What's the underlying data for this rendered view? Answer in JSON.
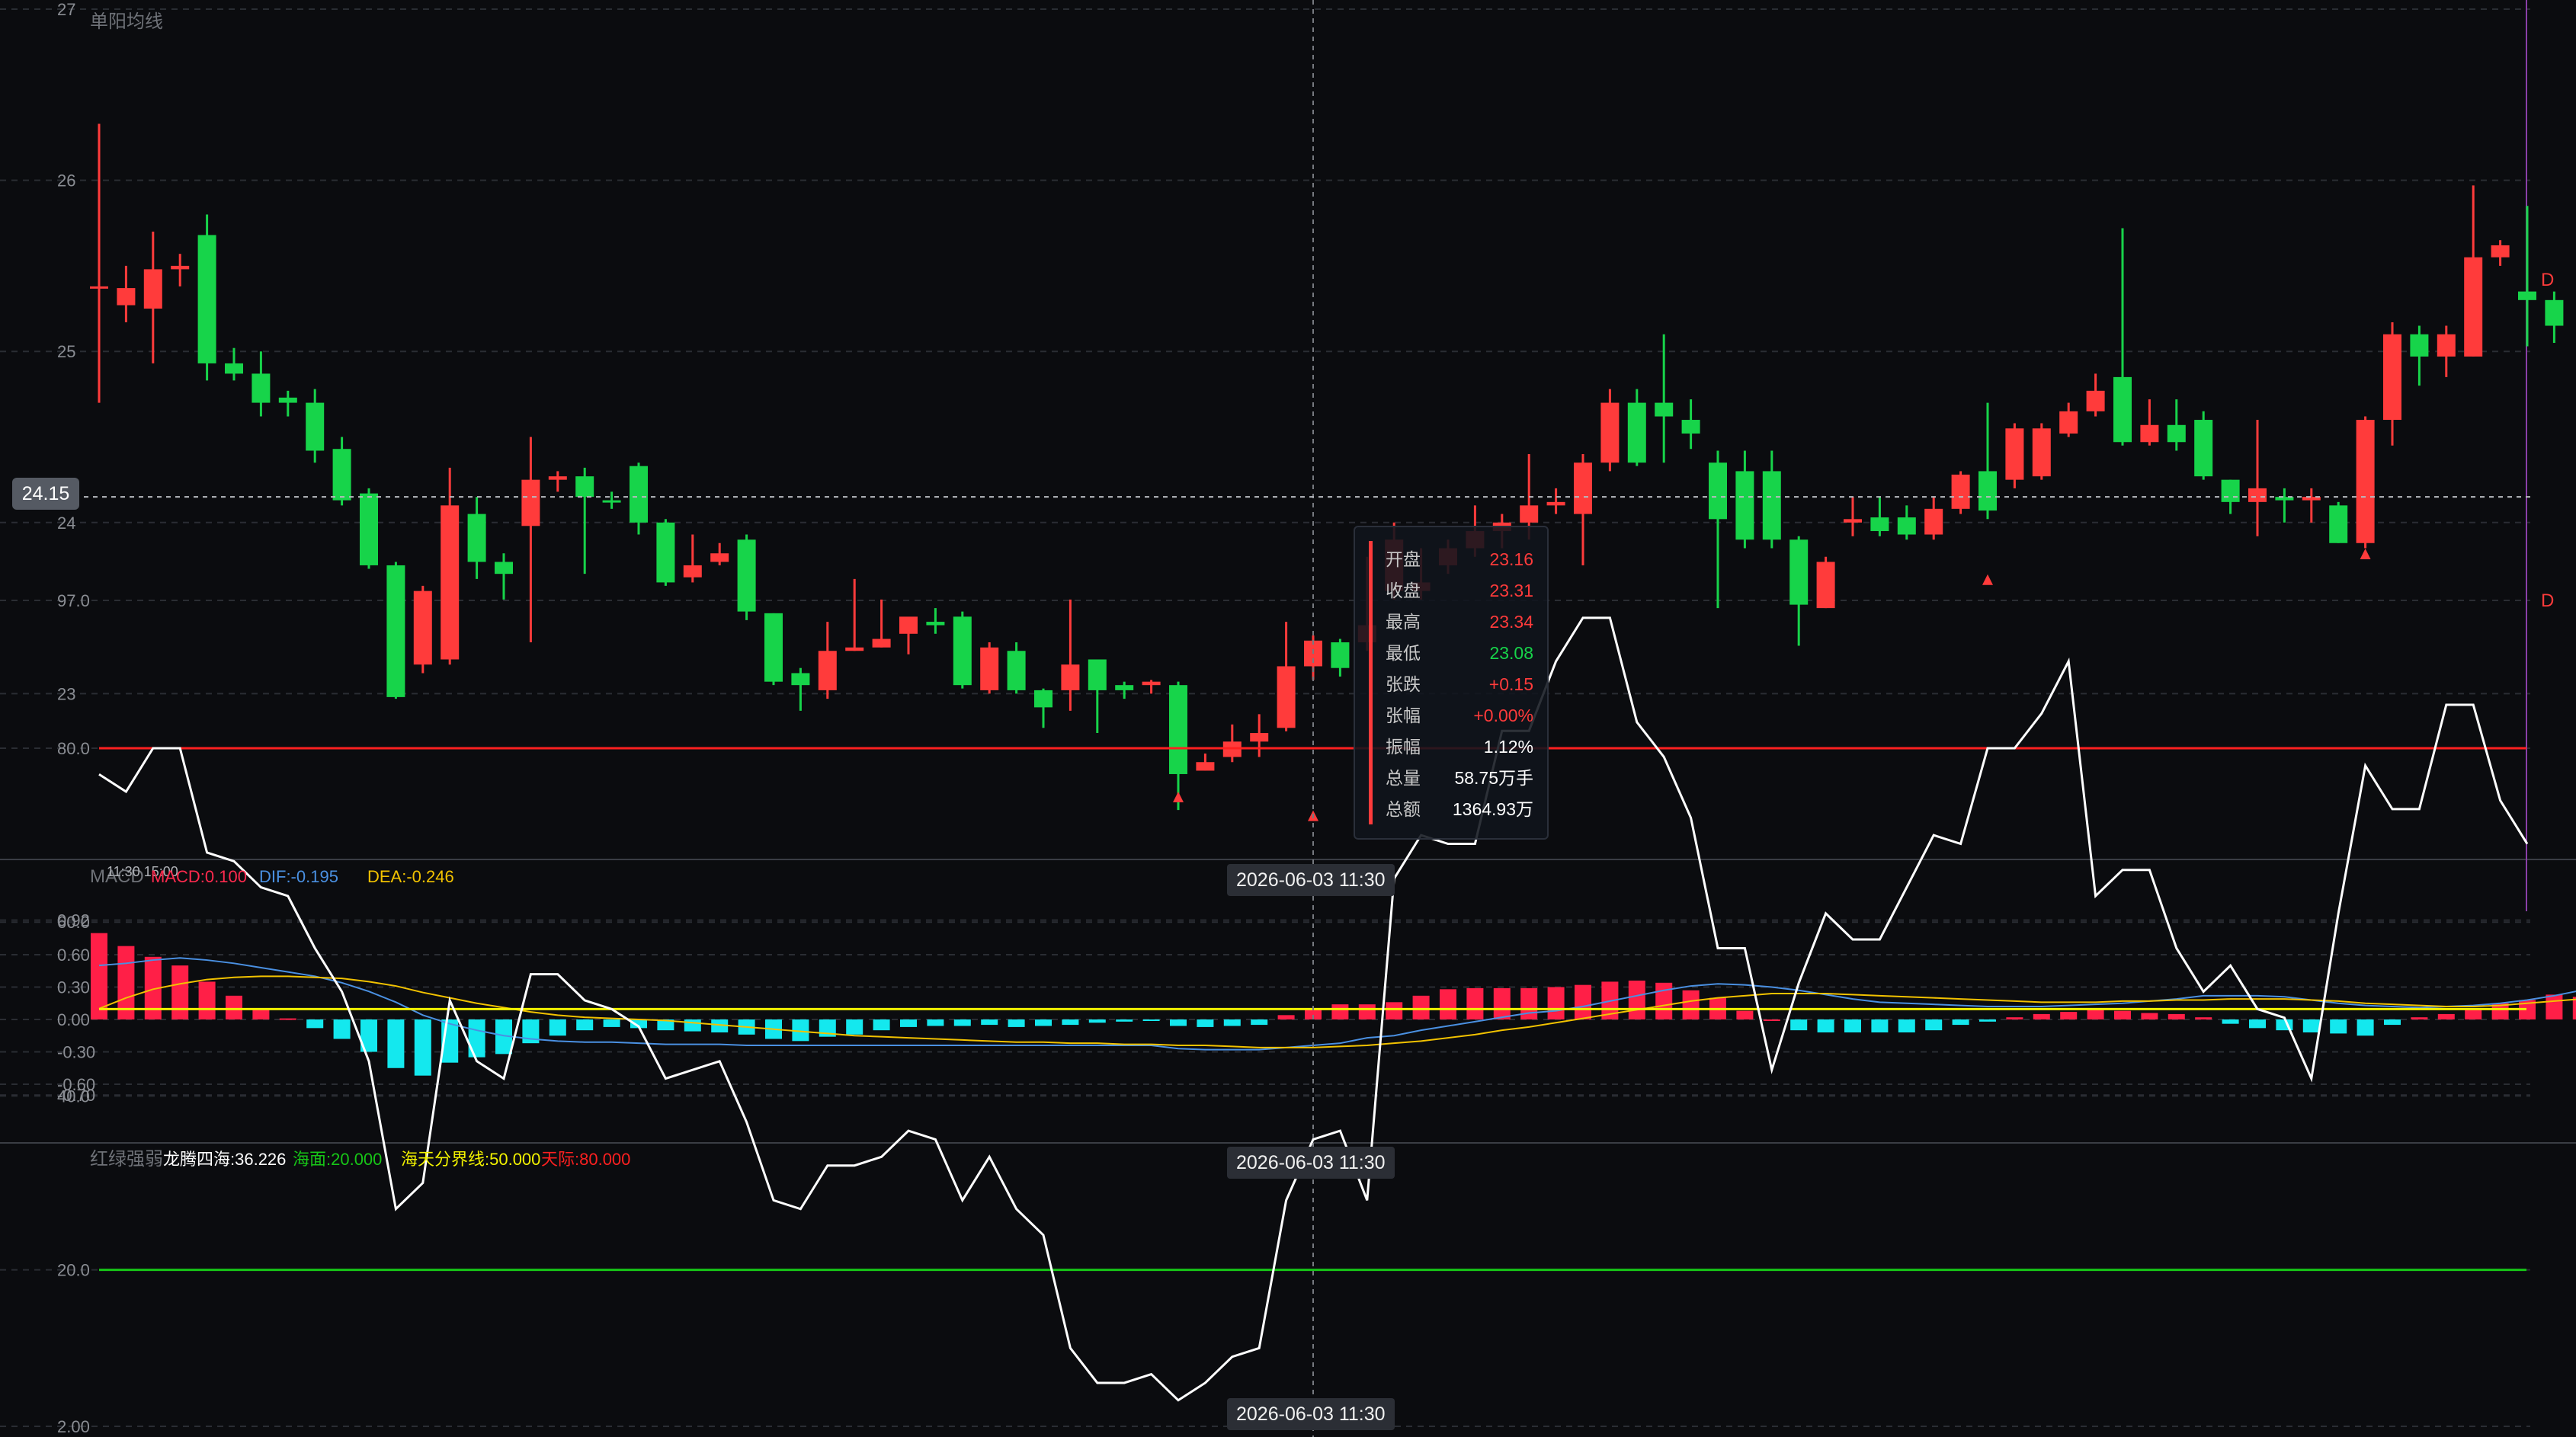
{
  "panels": {
    "main": {
      "title": "单阳均线",
      "price_marker": "24.15",
      "right_markers": [
        "D",
        "D"
      ]
    },
    "macd": {
      "label": "MACD",
      "legend": [
        {
          "text": "MACD:0.100",
          "color": "#ff2a4e"
        },
        {
          "text": "DIF:-0.195",
          "color": "#4a90e2"
        },
        {
          "text": "DEA:-0.246",
          "color": "#f2c200"
        }
      ],
      "overlap_text": "11:30 15:00"
    },
    "osc": {
      "label": "红绿强弱",
      "legend": [
        {
          "text": "龙腾四海:36.226",
          "color": "#ffffff"
        },
        {
          "text": "海面:20.000",
          "color": "#17c617"
        },
        {
          "text": "海天分界线:50.000",
          "color": "#f2f200"
        },
        {
          "text": "天际:80.000",
          "color": "#ff2020"
        }
      ]
    }
  },
  "crosshair": {
    "time_label": "2026-06-03 11:30",
    "price": "24.15"
  },
  "tooltip": {
    "rows": [
      {
        "k": "开盘",
        "v": "23.16",
        "color": "#ff3b3b"
      },
      {
        "k": "收盘",
        "v": "23.31",
        "color": "#ff3b3b"
      },
      {
        "k": "最高",
        "v": "23.34",
        "color": "#ff3b3b"
      },
      {
        "k": "最低",
        "v": "23.08",
        "color": "#17d44a"
      },
      {
        "k": "张跌",
        "v": "+0.15",
        "color": "#ff3b3b"
      },
      {
        "k": "张幅",
        "v": "+0.00%",
        "color": "#ff3b3b"
      },
      {
        "k": "振幅",
        "v": "1.12%",
        "color": "#ffffff"
      },
      {
        "k": "总量",
        "v": "58.75万手",
        "color": "#ffffff"
      },
      {
        "k": "总额",
        "v": "1364.93万",
        "color": "#ffffff"
      }
    ]
  },
  "colors": {
    "up": "#ff3b3b",
    "down": "#17d44a",
    "macd_up": "#ff1f47",
    "macd_down": "#14e8ee",
    "dif": "#4a90e2",
    "dea": "#f2c200",
    "osc_line": "#ffffff",
    "level_80": "#ff2020",
    "level_50": "#f2f200",
    "level_20": "#17c617",
    "grid": "#2a2d33"
  },
  "chart_data": [
    {
      "type": "candlestick",
      "title": "单阳均线",
      "ylim": [
        22.0,
        27.0
      ],
      "yticks": [
        "27",
        "26",
        "25",
        "24",
        "23"
      ],
      "ohlc": [
        [
          25.37,
          25.38,
          26.33,
          24.7
        ],
        [
          25.27,
          25.37,
          25.5,
          25.17
        ],
        [
          25.25,
          25.48,
          25.7,
          24.93
        ],
        [
          25.48,
          25.5,
          25.57,
          25.38
        ],
        [
          25.68,
          24.93,
          25.8,
          24.83
        ],
        [
          24.93,
          24.87,
          25.02,
          24.83
        ],
        [
          24.87,
          24.7,
          25.0,
          24.62
        ],
        [
          24.73,
          24.7,
          24.77,
          24.62
        ],
        [
          24.7,
          24.42,
          24.78,
          24.35
        ],
        [
          24.43,
          24.13,
          24.5,
          24.1
        ],
        [
          24.17,
          23.75,
          24.2,
          23.73
        ],
        [
          23.75,
          22.98,
          23.77,
          22.97
        ],
        [
          23.17,
          23.6,
          23.63,
          23.12
        ],
        [
          23.2,
          24.1,
          24.32,
          23.17
        ],
        [
          24.05,
          23.77,
          24.15,
          23.67
        ],
        [
          23.77,
          23.7,
          23.82,
          23.55
        ],
        [
          23.98,
          24.25,
          24.5,
          23.3
        ],
        [
          24.25,
          24.27,
          24.3,
          24.18
        ],
        [
          24.27,
          24.15,
          24.32,
          23.7
        ],
        [
          24.13,
          24.12,
          24.18,
          24.08
        ],
        [
          24.33,
          24.0,
          24.35,
          23.93
        ],
        [
          24.0,
          23.65,
          24.02,
          23.63
        ],
        [
          23.68,
          23.75,
          23.93,
          23.65
        ],
        [
          23.77,
          23.82,
          23.88,
          23.75
        ],
        [
          23.9,
          23.48,
          23.93,
          23.43
        ],
        [
          23.47,
          23.07,
          23.47,
          23.05
        ],
        [
          23.12,
          23.05,
          23.15,
          22.9
        ],
        [
          23.02,
          23.25,
          23.42,
          22.97
        ],
        [
          23.25,
          23.27,
          23.67,
          23.25
        ],
        [
          23.27,
          23.32,
          23.55,
          23.27
        ],
        [
          23.35,
          23.45,
          23.43,
          23.23
        ],
        [
          23.42,
          23.4,
          23.5,
          23.35
        ],
        [
          23.45,
          23.05,
          23.48,
          23.03
        ],
        [
          23.02,
          23.27,
          23.3,
          23.0
        ],
        [
          23.25,
          23.02,
          23.3,
          23.0
        ],
        [
          23.02,
          22.92,
          23.03,
          22.8
        ],
        [
          23.02,
          23.17,
          23.55,
          22.9
        ],
        [
          23.2,
          23.02,
          23.2,
          22.77
        ],
        [
          23.05,
          23.02,
          23.07,
          22.97
        ],
        [
          23.05,
          23.07,
          23.08,
          23.0
        ],
        [
          23.05,
          22.53,
          23.07,
          22.32
        ],
        [
          22.55,
          22.6,
          22.65,
          22.55
        ],
        [
          22.63,
          22.72,
          22.82,
          22.6
        ],
        [
          22.72,
          22.77,
          22.88,
          22.63
        ],
        [
          22.8,
          23.16,
          23.42,
          22.78
        ],
        [
          23.16,
          23.31,
          23.34,
          23.08
        ],
        [
          23.3,
          23.15,
          23.32,
          23.1
        ],
        [
          23.3,
          23.4,
          23.8,
          23.25
        ],
        [
          23.6,
          23.9,
          24.0,
          23.55
        ],
        [
          23.6,
          23.65,
          23.85,
          23.55
        ],
        [
          23.75,
          23.85,
          23.9,
          23.7
        ],
        [
          23.85,
          23.95,
          24.1,
          23.8
        ],
        [
          23.95,
          24.0,
          24.05,
          23.85
        ],
        [
          24.0,
          24.1,
          24.4,
          23.9
        ],
        [
          24.1,
          24.12,
          24.2,
          24.05
        ],
        [
          24.05,
          24.35,
          24.4,
          23.75
        ],
        [
          24.35,
          24.7,
          24.78,
          24.3
        ],
        [
          24.7,
          24.35,
          24.78,
          24.33
        ],
        [
          24.7,
          24.62,
          25.1,
          24.35
        ],
        [
          24.6,
          24.52,
          24.72,
          24.43
        ],
        [
          24.35,
          24.02,
          24.42,
          23.5
        ],
        [
          24.3,
          23.9,
          24.42,
          23.85
        ],
        [
          24.3,
          23.9,
          24.42,
          23.85
        ],
        [
          23.9,
          23.52,
          23.92,
          23.28
        ],
        [
          23.5,
          23.77,
          23.8,
          23.5
        ],
        [
          24.0,
          24.02,
          24.15,
          23.92
        ],
        [
          24.03,
          23.95,
          24.15,
          23.92
        ],
        [
          24.03,
          23.93,
          24.1,
          23.9
        ],
        [
          23.93,
          24.08,
          24.15,
          23.9
        ],
        [
          24.08,
          24.28,
          24.3,
          24.05
        ],
        [
          24.3,
          24.07,
          24.7,
          24.02
        ],
        [
          24.25,
          24.55,
          24.58,
          24.2
        ],
        [
          24.27,
          24.55,
          24.58,
          24.25
        ],
        [
          24.52,
          24.65,
          24.7,
          24.5
        ],
        [
          24.65,
          24.77,
          24.87,
          24.62
        ],
        [
          24.85,
          24.47,
          25.72,
          24.45
        ],
        [
          24.47,
          24.57,
          24.72,
          24.45
        ],
        [
          24.57,
          24.47,
          24.72,
          24.42
        ],
        [
          24.6,
          24.27,
          24.65,
          24.25
        ],
        [
          24.25,
          24.12,
          24.25,
          24.05
        ],
        [
          24.12,
          24.2,
          24.6,
          23.92
        ],
        [
          24.15,
          24.13,
          24.2,
          24.0
        ],
        [
          24.13,
          24.15,
          24.2,
          24.0
        ],
        [
          24.1,
          23.88,
          24.12,
          23.88
        ],
        [
          23.88,
          24.6,
          24.62,
          23.85
        ],
        [
          24.6,
          25.1,
          25.17,
          24.45
        ],
        [
          25.1,
          24.97,
          25.15,
          24.8
        ],
        [
          24.97,
          25.1,
          25.15,
          24.85
        ],
        [
          24.97,
          25.55,
          25.97,
          24.97
        ],
        [
          25.55,
          25.62,
          25.65,
          25.5
        ],
        [
          25.35,
          25.3,
          25.85,
          25.03
        ],
        [
          25.3,
          25.15,
          25.35,
          25.05
        ]
      ],
      "signals": [
        {
          "i": 40,
          "type": "up-arrow",
          "value": 22.53
        },
        {
          "i": 45,
          "type": "up-arrow",
          "value": 22.42
        },
        {
          "i": 70,
          "type": "up-arrow",
          "value": 23.8
        },
        {
          "i": 84,
          "type": "up-arrow",
          "value": 23.95
        }
      ]
    },
    {
      "type": "bar+line",
      "title": "MACD",
      "ylim": [
        -0.7,
        0.92
      ],
      "yticks": [
        "0.92",
        "0.60",
        "0.30",
        "0.00",
        "-0.30",
        "-0.60",
        "-0.70"
      ],
      "series": [
        {
          "name": "MACD",
          "kind": "bar",
          "values": [
            0.8,
            0.68,
            0.58,
            0.5,
            0.35,
            0.22,
            0.1,
            0.01,
            -0.08,
            -0.18,
            -0.3,
            -0.45,
            -0.52,
            -0.4,
            -0.35,
            -0.32,
            -0.22,
            -0.15,
            -0.1,
            -0.07,
            -0.08,
            -0.1,
            -0.11,
            -0.12,
            -0.14,
            -0.18,
            -0.2,
            -0.16,
            -0.14,
            -0.1,
            -0.07,
            -0.06,
            -0.06,
            -0.05,
            -0.07,
            -0.06,
            -0.05,
            -0.03,
            -0.02,
            -0.01,
            -0.06,
            -0.07,
            -0.06,
            -0.05,
            0.04,
            0.1,
            0.14,
            0.14,
            0.16,
            0.22,
            0.28,
            0.29,
            0.29,
            0.29,
            0.3,
            0.32,
            0.35,
            0.36,
            0.34,
            0.27,
            0.2,
            0.08,
            0.0,
            -0.1,
            -0.12,
            -0.12,
            -0.12,
            -0.12,
            -0.1,
            -0.05,
            -0.02,
            0.02,
            0.05,
            0.07,
            0.09,
            0.08,
            0.06,
            0.05,
            0.02,
            -0.04,
            -0.08,
            -0.1,
            -0.12,
            -0.13,
            -0.15,
            -0.05,
            0.02,
            0.05,
            0.09,
            0.15,
            0.18,
            0.23,
            0.21,
            0.16
          ]
        },
        {
          "name": "DIF",
          "kind": "line",
          "values": [
            0.5,
            0.52,
            0.55,
            0.57,
            0.55,
            0.52,
            0.48,
            0.44,
            0.4,
            0.34,
            0.26,
            0.16,
            0.04,
            -0.04,
            -0.1,
            -0.15,
            -0.18,
            -0.2,
            -0.21,
            -0.21,
            -0.22,
            -0.23,
            -0.23,
            -0.23,
            -0.24,
            -0.24,
            -0.24,
            -0.24,
            -0.24,
            -0.24,
            -0.24,
            -0.24,
            -0.24,
            -0.24,
            -0.24,
            -0.24,
            -0.24,
            -0.24,
            -0.24,
            -0.24,
            -0.27,
            -0.28,
            -0.28,
            -0.28,
            -0.26,
            -0.24,
            -0.22,
            -0.17,
            -0.15,
            -0.1,
            -0.06,
            -0.02,
            0.02,
            0.06,
            0.08,
            0.12,
            0.17,
            0.22,
            0.27,
            0.31,
            0.33,
            0.32,
            0.3,
            0.27,
            0.23,
            0.19,
            0.16,
            0.15,
            0.14,
            0.13,
            0.12,
            0.12,
            0.12,
            0.13,
            0.14,
            0.15,
            0.17,
            0.19,
            0.22,
            0.22,
            0.22,
            0.21,
            0.18,
            0.15,
            0.13,
            0.12,
            0.11,
            0.12,
            0.13,
            0.15,
            0.18,
            0.22,
            0.27,
            0.31,
            0.32
          ]
        },
        {
          "name": "DEA",
          "kind": "line",
          "values": [
            0.1,
            0.2,
            0.28,
            0.33,
            0.37,
            0.39,
            0.4,
            0.4,
            0.39,
            0.38,
            0.35,
            0.31,
            0.25,
            0.2,
            0.15,
            0.11,
            0.07,
            0.04,
            0.02,
            0.01,
            0.0,
            -0.01,
            -0.03,
            -0.05,
            -0.07,
            -0.09,
            -0.11,
            -0.13,
            -0.15,
            -0.16,
            -0.17,
            -0.18,
            -0.19,
            -0.2,
            -0.21,
            -0.21,
            -0.22,
            -0.22,
            -0.23,
            -0.23,
            -0.24,
            -0.24,
            -0.25,
            -0.26,
            -0.26,
            -0.26,
            -0.25,
            -0.24,
            -0.22,
            -0.2,
            -0.17,
            -0.14,
            -0.1,
            -0.07,
            -0.03,
            0.01,
            0.05,
            0.09,
            0.13,
            0.17,
            0.2,
            0.22,
            0.24,
            0.24,
            0.24,
            0.23,
            0.22,
            0.21,
            0.2,
            0.19,
            0.18,
            0.17,
            0.16,
            0.16,
            0.16,
            0.17,
            0.17,
            0.18,
            0.18,
            0.19,
            0.19,
            0.19,
            0.18,
            0.17,
            0.15,
            0.14,
            0.13,
            0.12,
            0.12,
            0.13,
            0.15,
            0.17,
            0.19,
            0.22,
            0.24
          ]
        }
      ]
    },
    {
      "type": "line",
      "title": "红绿强弱",
      "ylim": [
        2.0,
        97.0
      ],
      "yticks": [
        "97.0",
        "80.0",
        "60.0",
        "40.0",
        "20.0",
        "2.00"
      ],
      "levels": [
        {
          "name": "天际",
          "value": 80.0
        },
        {
          "name": "海天分界线",
          "value": 50.0
        },
        {
          "name": "海面",
          "value": 20.0
        }
      ],
      "series": [
        {
          "name": "龙腾四海",
          "values": [
            77,
            75,
            80,
            80,
            68,
            67,
            64,
            63,
            57,
            52,
            44,
            27,
            30,
            51,
            44,
            42,
            54,
            54,
            51,
            50,
            48,
            42,
            43,
            44,
            37,
            28,
            27,
            32,
            32,
            33,
            36,
            35,
            28,
            33,
            27,
            24,
            11,
            7,
            7,
            8,
            5,
            7,
            10,
            11,
            28,
            35,
            36,
            28,
            65,
            70,
            69,
            69,
            82,
            82,
            90,
            95,
            95,
            83,
            79,
            72,
            57,
            57,
            43,
            53,
            61,
            58,
            58,
            64,
            70,
            69,
            80,
            80,
            84,
            90,
            63,
            66,
            66,
            57,
            52,
            55,
            50,
            49,
            42,
            61,
            78,
            73,
            73,
            85,
            85,
            74,
            69
          ]
        }
      ]
    }
  ]
}
